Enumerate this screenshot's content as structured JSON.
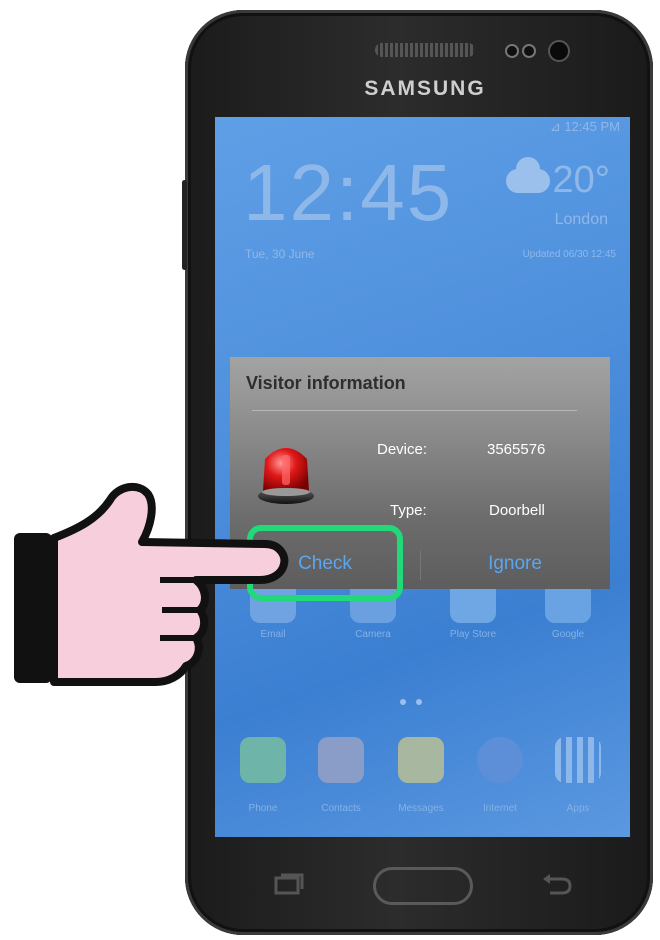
{
  "phone": {
    "brand": "SAMSUNG"
  },
  "lockscreen": {
    "status": "⊿ 12:45 PM",
    "time": "12:45",
    "date": "Tue, 30 June",
    "temperature": "20°",
    "location": "London",
    "updated": "Updated 06/30 12:45"
  },
  "home_apps": {
    "row1": [
      "Email",
      "Camera",
      "Play Store",
      "Google"
    ],
    "dock": [
      "Phone",
      "Contacts",
      "Messages",
      "Internet",
      "Apps"
    ]
  },
  "dialog": {
    "title": "Visitor information",
    "device_label": "Device:",
    "device_value": "3565576",
    "type_label": "Type:",
    "type_value": "Doorbell",
    "check_label": "Check",
    "ignore_label": "Ignore"
  },
  "colors": {
    "highlight": "#22d97a",
    "button_text": "#59a6f0",
    "screen": "#4e8fdc"
  },
  "icons": [
    "siren-icon",
    "pointing-hand-icon",
    "phone-icon",
    "contacts-icon",
    "messages-icon",
    "internet-icon",
    "apps-icon"
  ]
}
